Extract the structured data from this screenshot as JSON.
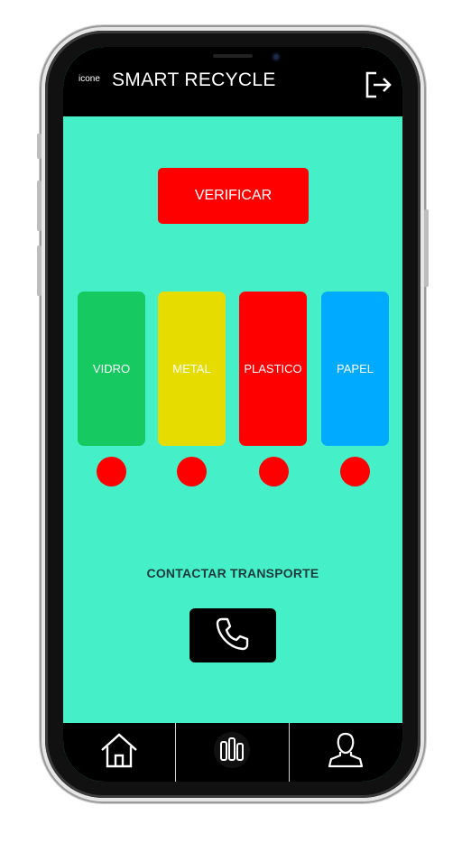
{
  "header": {
    "icon_label": "icone",
    "title": "SMART RECYCLE",
    "logout_icon": "logout-icon"
  },
  "main": {
    "verify_label": "VERIFICAR",
    "bins": [
      {
        "label": "VIDRO",
        "color": "#16c960"
      },
      {
        "label": "METAL",
        "color": "#e6dc00"
      },
      {
        "label": "PLASTICO",
        "color": "#ff0000"
      },
      {
        "label": "PAPEL",
        "color": "#00aaff"
      }
    ],
    "indicator_color": "#ff0000",
    "contact_label": "CONTACTAR TRANSPORTE",
    "phone_icon": "phone-icon"
  },
  "bottom_nav": {
    "items": [
      {
        "icon": "home-icon"
      },
      {
        "icon": "bar-chart-icon"
      },
      {
        "icon": "user-icon"
      }
    ]
  },
  "colors": {
    "screen_bg": "#45f0c8",
    "bar_bg": "#000000",
    "accent": "#ff0000"
  }
}
